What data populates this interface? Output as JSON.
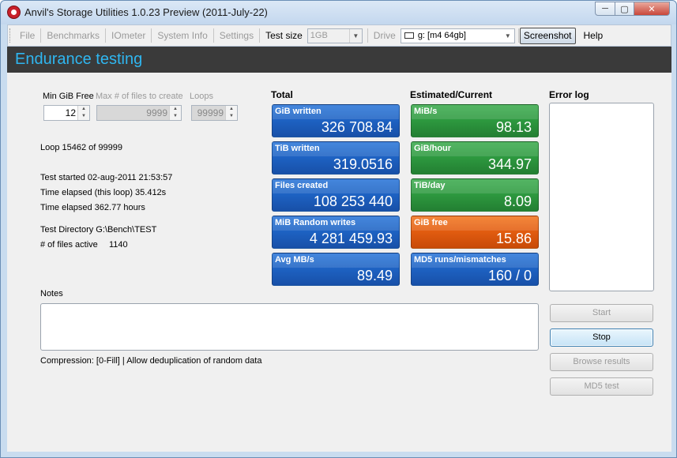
{
  "window": {
    "title": "Anvil's Storage Utilities 1.0.23 Preview (2011-July-22)"
  },
  "menu": {
    "file": "File",
    "benchmarks": "Benchmarks",
    "iometer": "IOmeter",
    "system_info": "System Info",
    "settings": "Settings",
    "test_size_label": "Test size",
    "test_size_value": "1GB",
    "drive_label": "Drive",
    "drive_value": "g: [m4 64gb]",
    "screenshot": "Screenshot",
    "help": "Help"
  },
  "header": {
    "title": "Endurance testing"
  },
  "params": {
    "min_free_label": "Min GiB Free",
    "min_free_value": "12",
    "max_files_label": "Max # of files to create",
    "max_files_value": "9999",
    "loops_label": "Loops",
    "loops_value": "99999"
  },
  "info": {
    "loop": "Loop 15462 of 99999",
    "test_started": "Test started 02-aug-2011 21:53:57",
    "elapsed_loop": "Time elapsed (this loop) 35.412s",
    "elapsed_total": "Time elapsed 362.77 hours",
    "test_directory": "Test Directory G:\\Bench\\TEST",
    "files_active_label": "# of files active",
    "files_active_value": "1140"
  },
  "total": {
    "heading": "Total",
    "tiles": [
      {
        "label": "GiB written",
        "value": "326 708.84",
        "color": "#1e63c4"
      },
      {
        "label": "TiB written",
        "value": "319.0516",
        "color": "#1e63c4"
      },
      {
        "label": "Files created",
        "value": "108 253 440",
        "color": "#1e63c4"
      },
      {
        "label": "MiB Random writes",
        "value": "4 281 459.93",
        "color": "#1e63c4"
      },
      {
        "label": "Avg MB/s",
        "value": "89.49",
        "color": "#1e63c4"
      }
    ]
  },
  "current": {
    "heading": "Estimated/Current",
    "tiles": [
      {
        "label": "MiB/s",
        "value": "98.13",
        "color": "#2e9a40"
      },
      {
        "label": "GiB/hour",
        "value": "344.97",
        "color": "#2e9a40"
      },
      {
        "label": "TiB/day",
        "value": "8.09",
        "color": "#2e9a40"
      },
      {
        "label": "GiB free",
        "value": "15.86",
        "color": "#e35d10"
      },
      {
        "label": "MD5 runs/mismatches",
        "value": "160 / 0",
        "color": "#1e63c4"
      }
    ]
  },
  "error_log": {
    "heading": "Error log"
  },
  "notes": {
    "label": "Notes",
    "compression": "Compression: [0-Fill]  | Allow deduplication of random data"
  },
  "buttons": {
    "start": "Start",
    "stop": "Stop",
    "browse_results": "Browse results",
    "md5_test": "MD5 test"
  }
}
